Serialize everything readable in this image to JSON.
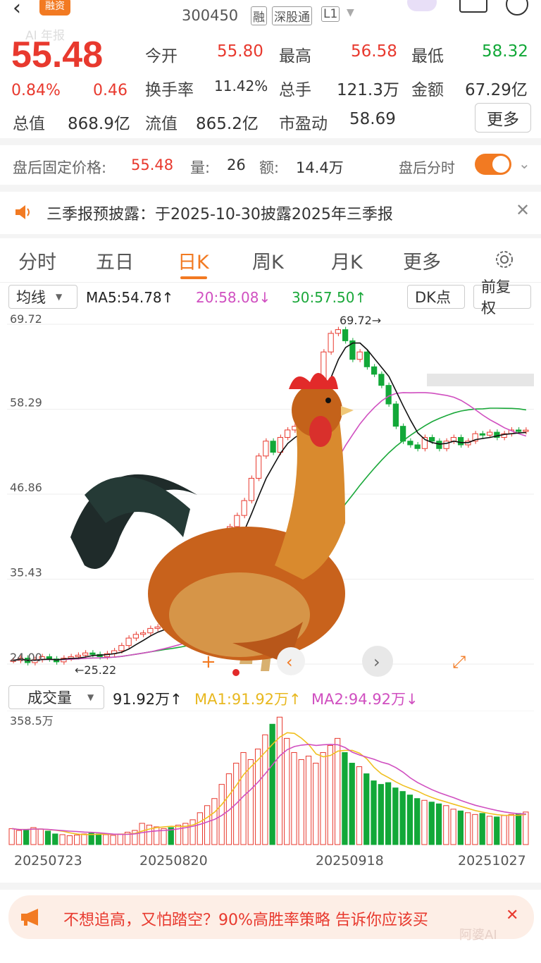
{
  "header": {
    "stock_code": "300450",
    "badges": [
      "融",
      "深股通",
      "L1"
    ],
    "app_logo": "融资",
    "ai_label": "AI 年报"
  },
  "quote": {
    "price": "55.48",
    "change_pct": "0.84%",
    "change": "0.46",
    "rows": [
      [
        {
          "label": "今开",
          "value": "55.80",
          "color": "red"
        },
        {
          "label": "最高",
          "value": "56.58",
          "color": "red"
        },
        {
          "label": "最低",
          "value": "58.32",
          "color": "green"
        }
      ],
      [
        {
          "label": "换手率",
          "value": "11.42%",
          "color": "gray"
        },
        {
          "label": "总手",
          "value": "121.3万",
          "color": "gray"
        },
        {
          "label": "金额",
          "value": "67.29亿",
          "color": "gray"
        }
      ],
      [
        {
          "label": "总值",
          "value": "868.9亿",
          "color": "gray"
        },
        {
          "label": "流值",
          "value": "865.2亿",
          "color": "gray"
        },
        {
          "label": "市盈动",
          "value": "58.69",
          "color": "gray"
        }
      ]
    ],
    "more_label": "更多"
  },
  "after_hours": {
    "label": "盘后固定价格:",
    "price": "55.48",
    "vol_label": "量:",
    "vol": "26",
    "amt_label": "额:",
    "amt": "14.4万",
    "toggle_label": "盘后分时"
  },
  "notice": {
    "text": "三季报预披露：于2025-10-30披露2025年三季报",
    "icon": "speaker-icon"
  },
  "tabs": [
    "分时",
    "五日",
    "日K",
    "周K",
    "月K",
    "更多",
    "gear-icon"
  ],
  "active_tab": "日K",
  "ma_row": {
    "selector": "均线",
    "ma5": "MA5:54.78↑",
    "ma20": "20:58.08↓",
    "ma30": "30:57.50↑",
    "dk": "DK点",
    "adjust": "前复权"
  },
  "chart_data": {
    "type": "candlestick",
    "y_ticks": [
      "69.72",
      "58.29",
      "46.86",
      "35.43",
      "24.00"
    ],
    "ylim": [
      24.0,
      69.72
    ],
    "high_mark": "69.72→",
    "low_mark": "←25.22",
    "close": [
      24.5,
      24.8,
      24.2,
      24.6,
      25.0,
      24.7,
      24.3,
      24.8,
      25.0,
      25.2,
      25.5,
      25.3,
      25.0,
      25.4,
      25.8,
      26.5,
      27.5,
      28.0,
      28.2,
      28.8,
      29.0,
      29.3,
      29.1,
      30.0,
      31.0,
      32.0,
      33.5,
      35.5,
      37.5,
      40.0,
      42.5,
      44.0,
      46.0,
      49.0,
      52.0,
      54.0,
      52.5,
      54.5,
      55.5,
      56.0,
      57.0,
      59.5,
      62.0,
      66.0,
      68.5,
      69.0,
      67.5,
      65.0,
      66.0,
      64.0,
      63.0,
      61.5,
      59.0,
      56.0,
      54.0,
      53.5,
      53.0,
      54.5,
      54.0,
      53.0,
      54.0,
      54.5,
      53.5,
      54.0,
      55.0,
      54.8,
      55.2,
      54.5,
      55.0,
      55.5,
      55.3,
      55.48
    ],
    "ma5_label": "MA5",
    "ma20_label": "MA20",
    "ma30_label": "MA30"
  },
  "volume": {
    "selector": "成交量",
    "value": "91.92万↑",
    "ma1": "MA1:91.92万↑",
    "ma2": "MA2:94.92万↓",
    "max_label": "358.5万",
    "max": 358.5,
    "values": [
      45,
      40,
      42,
      48,
      44,
      38,
      30,
      28,
      25,
      27,
      30,
      32,
      30,
      28,
      26,
      30,
      35,
      40,
      60,
      55,
      50,
      45,
      48,
      55,
      60,
      70,
      90,
      110,
      130,
      170,
      200,
      230,
      260,
      240,
      270,
      310,
      340,
      360,
      300,
      260,
      240,
      250,
      230,
      260,
      280,
      300,
      260,
      230,
      220,
      200,
      180,
      170,
      175,
      160,
      150,
      140,
      130,
      125,
      120,
      115,
      110,
      100,
      95,
      90,
      85,
      88,
      80,
      78,
      82,
      85,
      88,
      91.92
    ]
  },
  "dates": [
    "20250723",
    "20250820",
    "20250918",
    "20251027"
  ],
  "banner": {
    "text": "不想追高，又怕踏空？90%高胜率策略 告诉你应该买",
    "watermark": "阿婆AI"
  },
  "colors": {
    "up": "#e8392e",
    "down": "#12a838",
    "accent": "#f27a22",
    "ma5": "#111111",
    "ma20": "#d04fc0",
    "ma30": "#1aa83a"
  }
}
